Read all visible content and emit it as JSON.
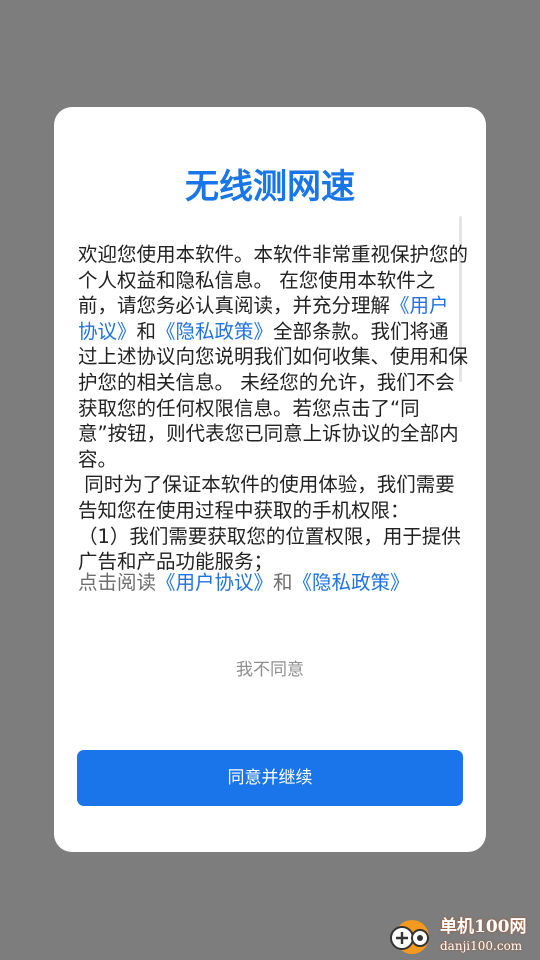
{
  "dialog": {
    "title": "无线测网速",
    "body": {
      "p1_a": "欢迎您使用本软件。本软件非常重视保护您的个人权益和隐私信息。 在您使用本软件之前，请您务必认真阅读，并充分理解",
      "p1_link1": "《用户协议》",
      "p1_and": "和",
      "p1_link2": "《隐私政策》",
      "p1_b": "全部条款。我们将通过上述协议向您说明我们如何收集、使用和保护您的相关信息。 未经您的允许，我们不会获取您的任何权限信息。若您点击了“同意”按钮，则代表您已同意上诉协议的全部内容。",
      "p2": " 同时为了保证本软件的使用体验，我们需要告知您在使用过程中获取的手机权限：",
      "p3": "（1）我们需要获取您的位置权限，用于提供广告和产品功能服务；"
    },
    "read_line": {
      "prefix": "点击阅读",
      "link1": "《用户协议》",
      "and": "和",
      "link2": "《隐私政策》"
    },
    "disagree_label": "我不同意",
    "agree_label": "同意并继续"
  },
  "watermark": {
    "name": "单机100网",
    "url": "danji100.com"
  },
  "colors": {
    "accent": "#1a75eb",
    "overlay": "#7d7d7d",
    "link": "#1f73e0"
  }
}
